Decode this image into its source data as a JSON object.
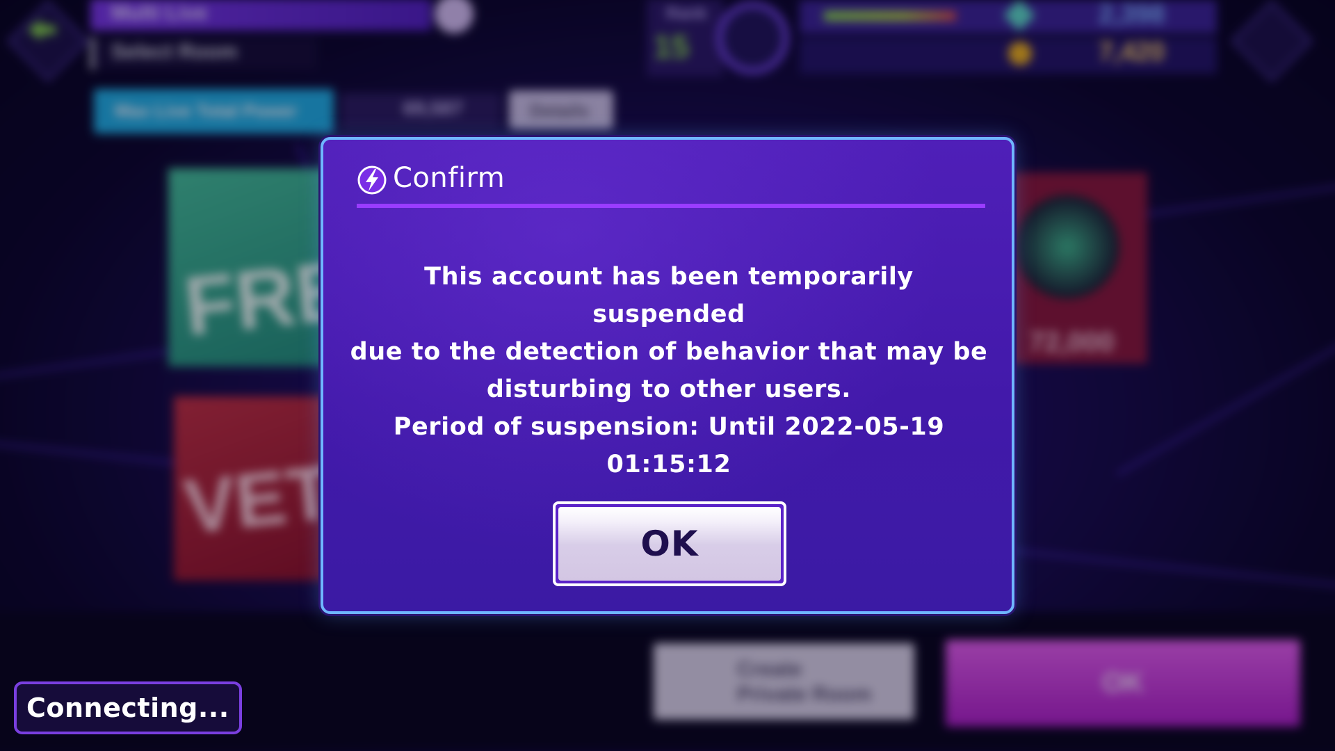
{
  "background": {
    "screen_title": "Multi Live",
    "screen_subtitle": "Select Room",
    "mission_button": "Max Live Total Power",
    "count_value": "69,587",
    "details_button": "Details",
    "rank_label": "Rank",
    "rank_value": "15",
    "gems_value": "2,398",
    "coins_value": "7,420",
    "card_free_label": "FRE",
    "card_vet_label": "VET",
    "card_right_value": "72,000",
    "private_room_button": "Create\nPrivate Room",
    "ok_button": "OK"
  },
  "dialog": {
    "title": "Confirm",
    "icon": "lightning-bolt-icon",
    "message_lines": [
      "This account has been temporarily suspended",
      "due to the detection of behavior that may be",
      "disturbing to other users.",
      "Period of suspension: Until 2022-05-19",
      "01:15:12"
    ],
    "ok_label": "OK"
  },
  "status": {
    "connecting_label": "Connecting..."
  },
  "colors": {
    "dialog_bg": "#4a1db2",
    "dialog_border": "#6fb6ff",
    "header_rule": "#9a3cff",
    "ok_text": "#1f0f4e",
    "connecting_border": "#7a3fe0"
  }
}
